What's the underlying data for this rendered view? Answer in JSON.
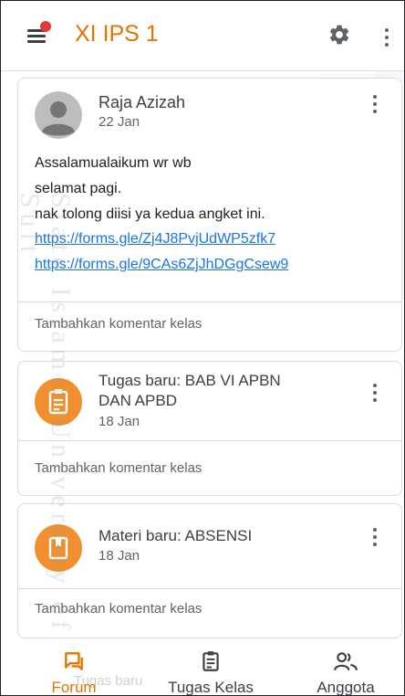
{
  "app": {
    "title": "XI IPS 1"
  },
  "posts": [
    {
      "author": "Raja Azizah",
      "date": "22 Jan",
      "lines": [
        "Assalamualaikum wr wb",
        "selamat pagi.",
        "nak tolong diisi ya kedua angket ini."
      ],
      "links": [
        "https://forms.gle/Zj4J8PvjUdWP5zfk7",
        "https://forms.gle/9CAs6ZjJhDGgCsew9"
      ],
      "comment_placeholder": "Tambahkan komentar kelas"
    },
    {
      "title_line1": "Tugas baru: BAB VI APBN",
      "title_line2": "DAN APBD",
      "date": "18 Jan",
      "icon": "assignment-icon",
      "comment_placeholder": "Tambahkan komentar kelas"
    },
    {
      "title": "Materi baru: ABSENSI",
      "date": "18 Jan",
      "icon": "material-icon",
      "comment_placeholder": "Tambahkan komentar kelas"
    }
  ],
  "watermark": {
    "text": "State Islamic University of Sult"
  },
  "peek_text": "Tugas baru",
  "nav": [
    {
      "label": "Forum",
      "icon": "forum-icon",
      "active": true
    },
    {
      "label": "Tugas Kelas",
      "icon": "assignment-icon",
      "active": false
    },
    {
      "label": "Anggota",
      "icon": "people-icon",
      "active": false
    }
  ],
  "colors": {
    "accent": "#e37400",
    "icon_bg": "#f08f2f",
    "link": "#1a73e8",
    "badge": "#e53935"
  }
}
